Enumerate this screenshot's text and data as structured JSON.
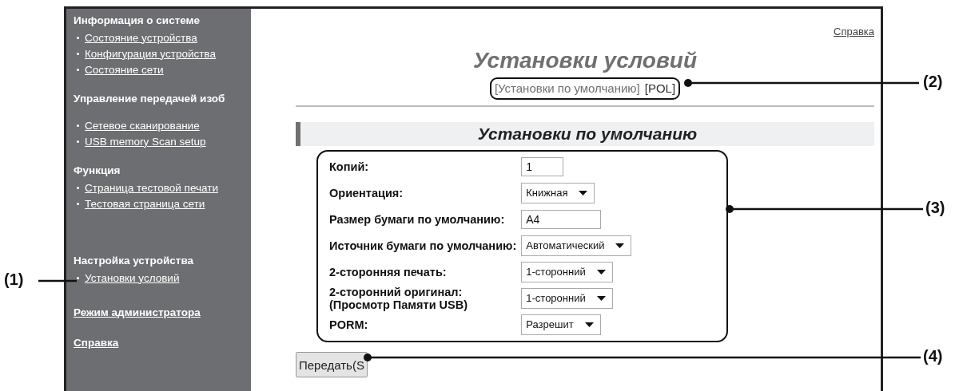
{
  "sidebar": {
    "sections": [
      {
        "heading": {
          "text": "Информация о системе",
          "kind": "heading"
        },
        "items": [
          "Состояние устройства",
          "Конфигурация устройства",
          "Состояние сети"
        ]
      },
      {
        "heading": {
          "text": "Управление передачей изоб",
          "kind": "heading"
        },
        "items": [
          "Сетевое сканирование",
          "USB memory Scan setup"
        ]
      },
      {
        "heading": {
          "text": "Функция",
          "kind": "heading"
        },
        "items": [
          "Страница тестовой печати",
          "Тестовая страница сети"
        ]
      },
      {
        "heading": {
          "text": "Настройка устройства",
          "kind": "heading"
        },
        "items": [
          "Установки условий"
        ]
      },
      {
        "heading": {
          "text": "Режим администратора",
          "kind": "link"
        }
      },
      {
        "heading": {
          "text": "Справка",
          "kind": "link"
        }
      }
    ]
  },
  "help_link": "Справка",
  "title": "Установки условий",
  "subtitle": "[Установки по умолчанию]",
  "subtitle_tag": "[POL]",
  "section_title": "Установки по умолчанию",
  "form": [
    {
      "label": "Копий:",
      "kind": "text",
      "value": "1"
    },
    {
      "label": "Ориентация:",
      "kind": "select",
      "value": "Книжная"
    },
    {
      "label": "Размер бумаги по умолчанию:",
      "kind": "text",
      "value": "A4"
    },
    {
      "label": "Источник бумаги по умолчанию:",
      "kind": "select",
      "value": "Автоматический"
    },
    {
      "label": "2-сторонняя печать:",
      "kind": "select",
      "value": "1-сторонний"
    },
    {
      "label": "2-сторонний оригинал:\n(Просмотр Памяти USB)",
      "kind": "select",
      "value": "1-сторонний"
    },
    {
      "label": "PORM:",
      "kind": "select",
      "value": "Разрешит"
    }
  ],
  "submit_button": "Передать(S",
  "callouts": [
    "(1)",
    "(2)",
    "(3)",
    "(4)"
  ]
}
